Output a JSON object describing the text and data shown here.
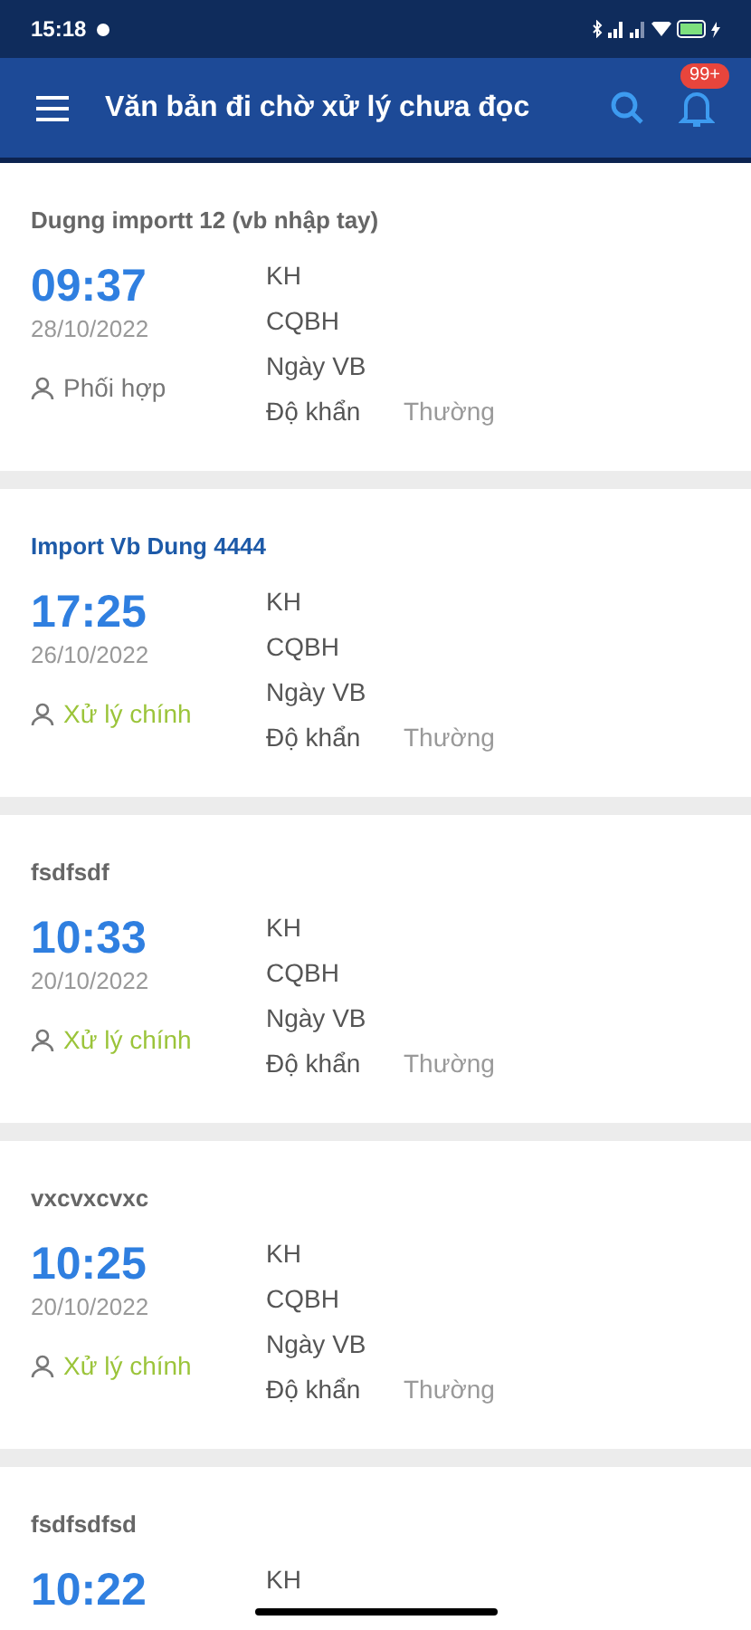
{
  "status_bar": {
    "time": "15:18"
  },
  "app_bar": {
    "title": "Văn bản đi chờ xử lý chưa đọc",
    "badge": "99+"
  },
  "documents": [
    {
      "title": "Dugng importt 12 (vb nhập tay)",
      "unread": false,
      "time": "09:37",
      "date": "28/10/2022",
      "role": "Phối hợp",
      "main_role": false,
      "fields": [
        {
          "label": "KH"
        },
        {
          "label": "CQBH"
        },
        {
          "label": "Ngày VB"
        },
        {
          "label": "Độ khẩn",
          "value": "Thường"
        }
      ]
    },
    {
      "title": "Import Vb Dung 4444",
      "unread": true,
      "time": "17:25",
      "date": "26/10/2022",
      "role": "Xử lý chính",
      "main_role": true,
      "fields": [
        {
          "label": "KH"
        },
        {
          "label": "CQBH"
        },
        {
          "label": "Ngày VB"
        },
        {
          "label": "Độ khẩn",
          "value": "Thường"
        }
      ]
    },
    {
      "title": "fsdfsdf",
      "unread": false,
      "time": "10:33",
      "date": "20/10/2022",
      "role": "Xử lý chính",
      "main_role": true,
      "fields": [
        {
          "label": "KH"
        },
        {
          "label": "CQBH"
        },
        {
          "label": "Ngày VB"
        },
        {
          "label": "Độ khẩn",
          "value": "Thường"
        }
      ]
    },
    {
      "title": "vxcvxcvxc",
      "unread": false,
      "time": "10:25",
      "date": "20/10/2022",
      "role": "Xử lý chính",
      "main_role": true,
      "fields": [
        {
          "label": "KH"
        },
        {
          "label": "CQBH"
        },
        {
          "label": "Ngày VB"
        },
        {
          "label": "Độ khẩn",
          "value": "Thường"
        }
      ]
    },
    {
      "title": "fsdfsdfsd",
      "unread": false,
      "time": "10:22",
      "fields": [
        {
          "label": "KH"
        }
      ]
    }
  ]
}
